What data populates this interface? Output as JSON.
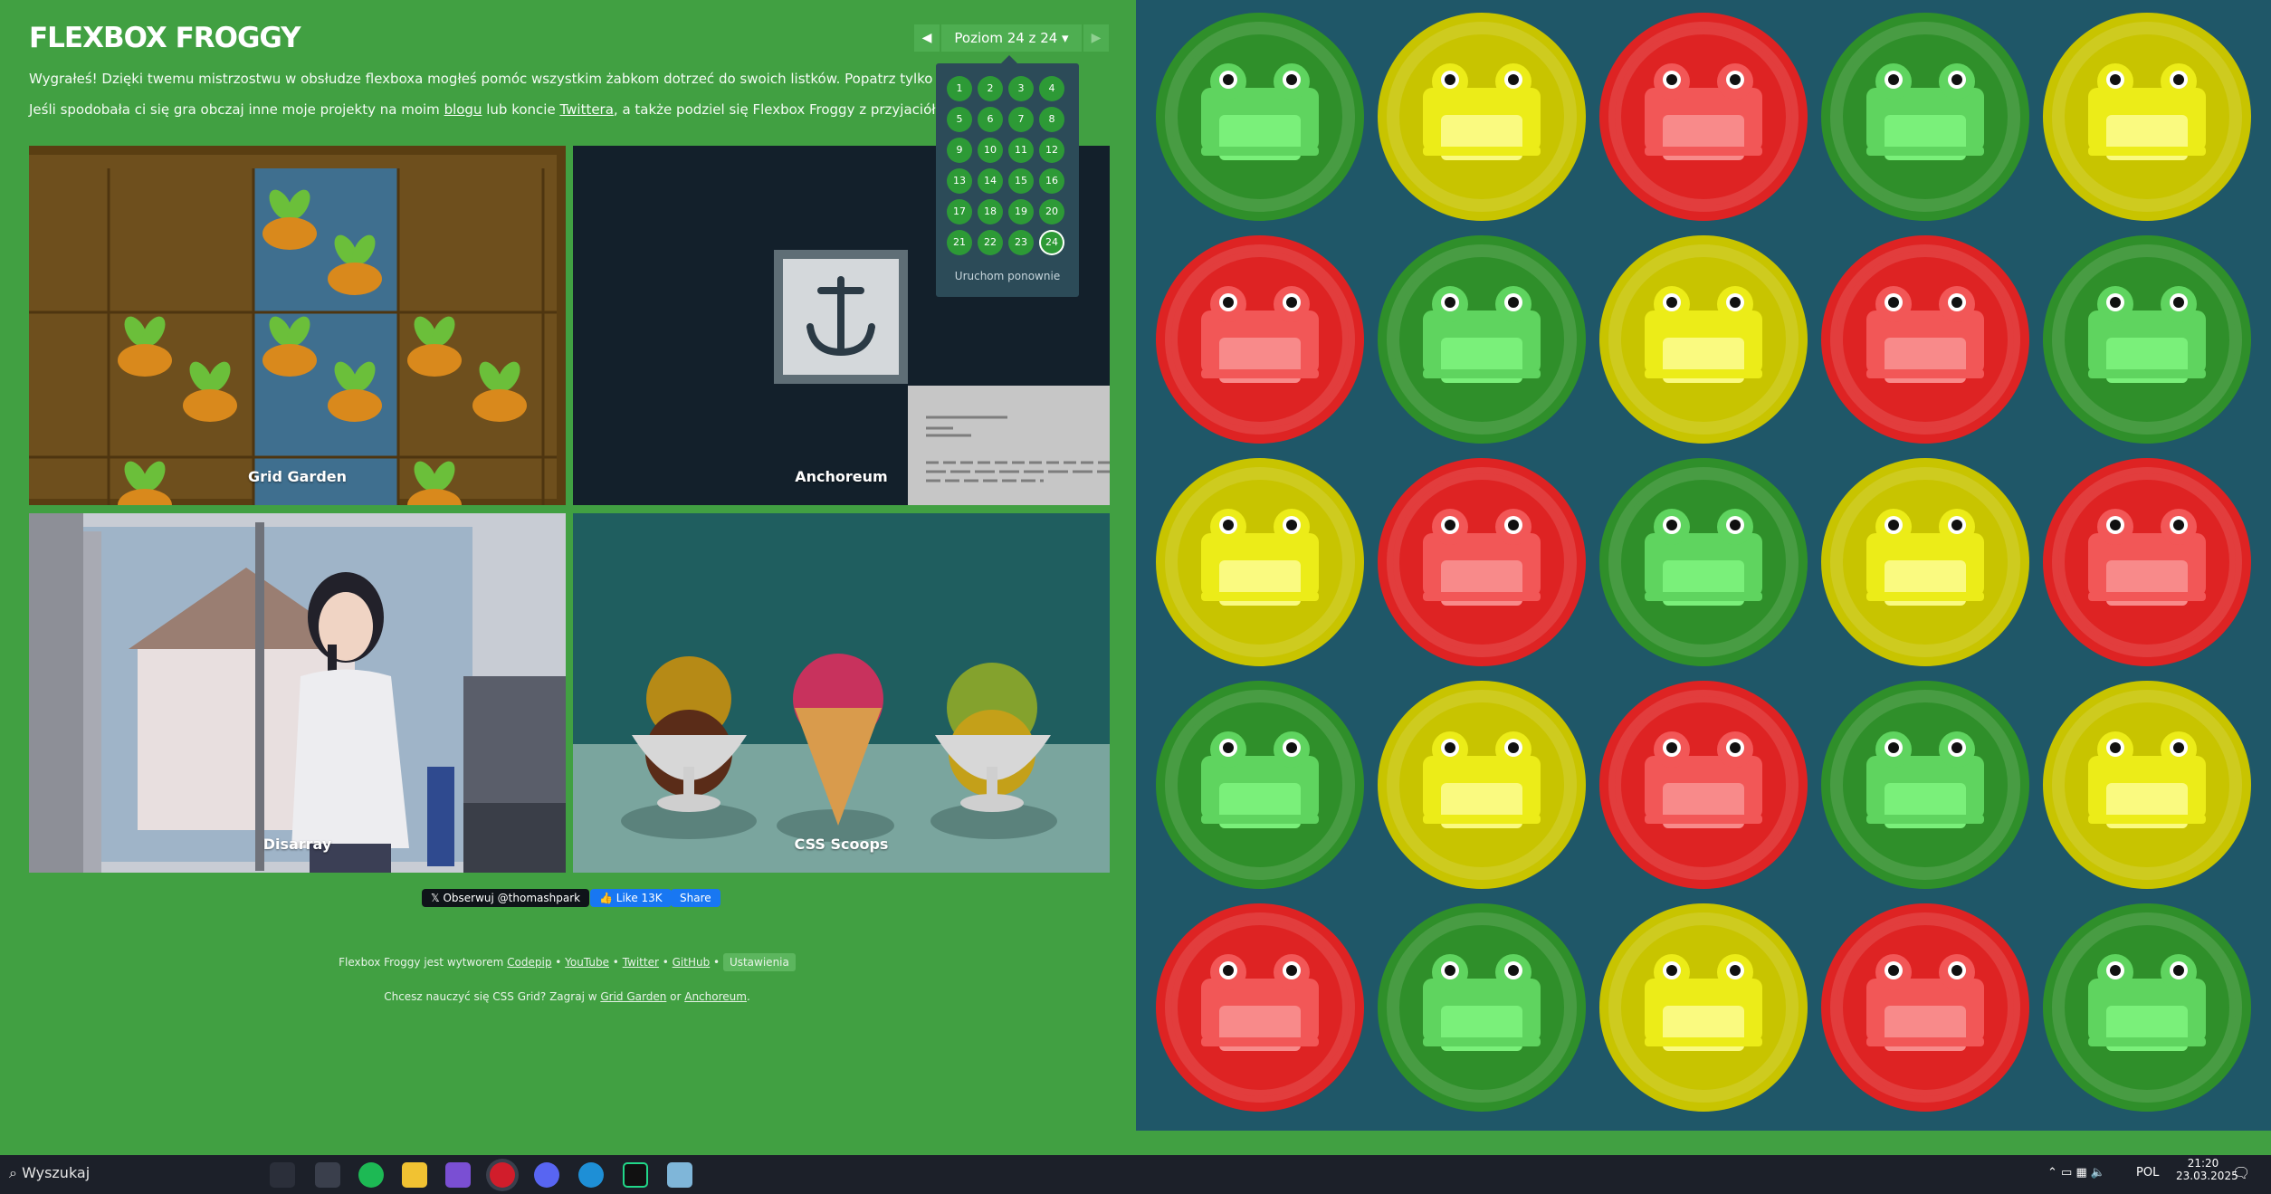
{
  "header": {
    "logo": "FLEXBOX FROGGY",
    "win_text": "Wygrałeś! Dzięki twemu mistrzostwu w obsłudze flexboxa mogłeś pomóc wszystkim żabkom dotrzeć do swoich listków. Popatrz tylko jakie są szczęśliwe!",
    "promo_pre": "Jeśli spodobała ci się gra obczaj inne moje projekty na moim ",
    "promo_blog": "blogu",
    "promo_mid": " lub koncie ",
    "promo_twitter": "Twittera",
    "promo_post": ", a także podziel się Flexbox Froggy z przyjaciółmi!"
  },
  "level_nav": {
    "label": "Poziom 24 z 24 ▾",
    "prev": "◀",
    "next": "▶",
    "levels": [
      "1",
      "2",
      "3",
      "4",
      "5",
      "6",
      "7",
      "8",
      "9",
      "10",
      "11",
      "12",
      "13",
      "14",
      "15",
      "16",
      "17",
      "18",
      "19",
      "20",
      "21",
      "22",
      "23",
      "24"
    ],
    "current": "24",
    "reset": "Uruchom ponownie"
  },
  "cards": {
    "grid_garden": "Grid Garden",
    "anchoreum": "Anchoreum",
    "disarray": "Disarray",
    "css_scoops": "CSS Scoops"
  },
  "social": {
    "twitter_follow": "Obserwuj @thomashpark",
    "fb_like": "Like 13K",
    "fb_share": "Share"
  },
  "footer": {
    "line1_pre": "Flexbox Froggy jest wytworem ",
    "codepip": "Codepip",
    "youtube": "YouTube",
    "twitter": "Twitter",
    "github": "GitHub",
    "sep": " • ",
    "settings": "Ustawienia",
    "line2_pre": "Chcesz nauczyć się CSS Grid? Zagraj w ",
    "grid_garden": "Grid Garden",
    "or": " or ",
    "anchoreum": "Anchoreum",
    "dot": "."
  },
  "pond": {
    "rows": [
      [
        "green",
        "yellow",
        "red",
        "green",
        "yellow"
      ],
      [
        "red",
        "green",
        "yellow",
        "red",
        "green"
      ],
      [
        "yellow",
        "red",
        "green",
        "yellow",
        "red"
      ],
      [
        "green",
        "yellow",
        "red",
        "green",
        "yellow"
      ],
      [
        "red",
        "green",
        "yellow",
        "red",
        "green"
      ]
    ],
    "colors": {
      "green": {
        "pad": "#2f8f2a",
        "frog": "#5fd45f",
        "belly": "#7af07a"
      },
      "yellow": {
        "pad": "#c8c400",
        "frog": "#ecec18",
        "belly": "#fafa80"
      },
      "red": {
        "pad": "#de2323",
        "frog": "#f25757",
        "belly": "#f88a8a"
      }
    }
  },
  "taskbar": {
    "search": "Wyszukaj",
    "lang": "POL",
    "time": "21:20",
    "date": "23.03.2025"
  }
}
